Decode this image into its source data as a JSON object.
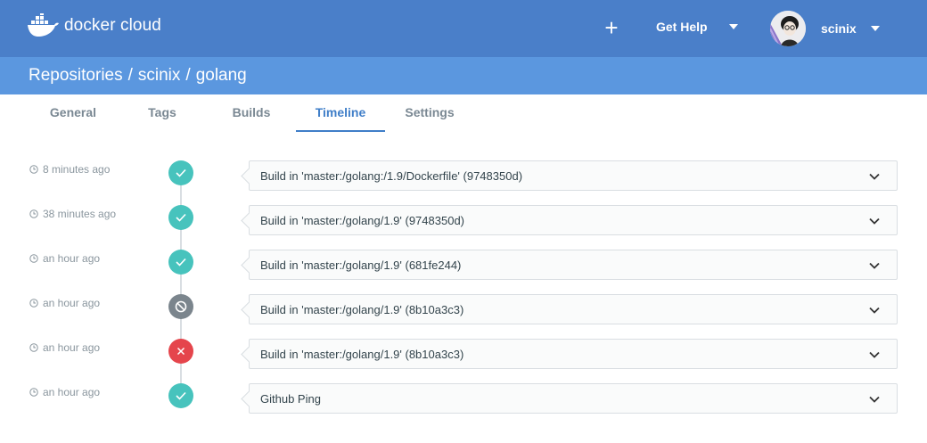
{
  "app": {
    "logo_text": "docker cloud",
    "brand_color": "#4a7fc9",
    "subheader_color": "#5b97df"
  },
  "topbar": {
    "create_icon": "plus-icon",
    "help_label": "Get Help",
    "username": "scinix"
  },
  "breadcrumb": {
    "items": [
      "Repositories",
      "scinix",
      "golang"
    ],
    "separator": "/"
  },
  "tabs": [
    {
      "label": "General",
      "active": false
    },
    {
      "label": "Tags",
      "active": false
    },
    {
      "label": "Builds",
      "active": false
    },
    {
      "label": "Timeline",
      "active": true
    },
    {
      "label": "Settings",
      "active": false
    }
  ],
  "timeline": {
    "events": [
      {
        "time": "8 minutes ago",
        "status": "success",
        "text": "Build in 'master:/golang:/1.9/Dockerfile' (9748350d)"
      },
      {
        "time": "38 minutes ago",
        "status": "success",
        "text": "Build in 'master:/golang/1.9' (9748350d)"
      },
      {
        "time": "an hour ago",
        "status": "success",
        "text": "Build in 'master:/golang/1.9' (681fe244)"
      },
      {
        "time": "an hour ago",
        "status": "canceled",
        "text": "Build in 'master:/golang/1.9' (8b10a3c3)"
      },
      {
        "time": "an hour ago",
        "status": "failed",
        "text": "Build in 'master:/golang/1.9' (8b10a3c3)"
      },
      {
        "time": "an hour ago",
        "status": "success",
        "text": "Github Ping"
      }
    ],
    "status_colors": {
      "success": "#47c3bd",
      "failed": "#e5454c",
      "canceled": "#7b858d"
    }
  }
}
